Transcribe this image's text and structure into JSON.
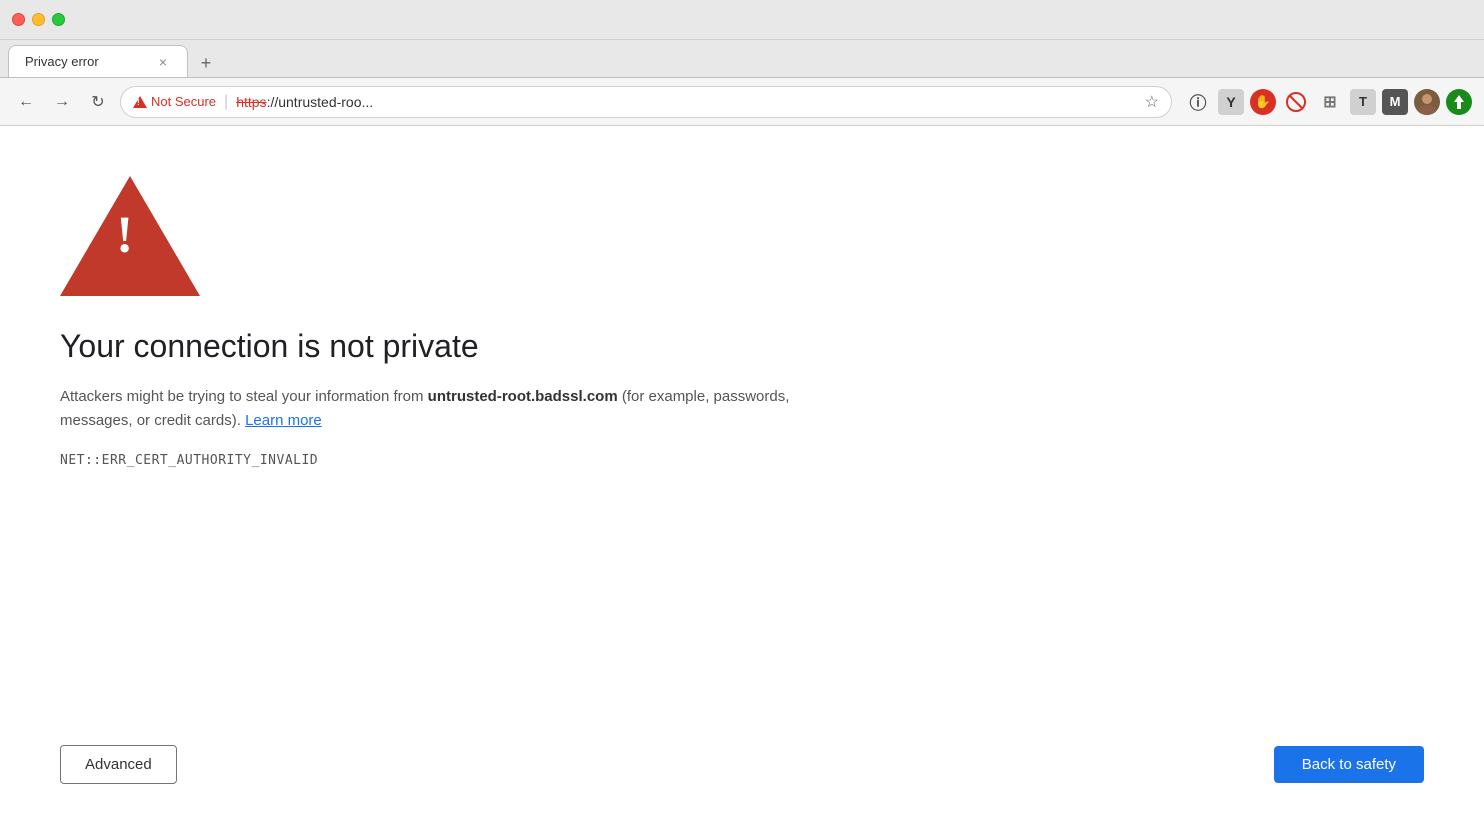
{
  "window": {
    "tab_title": "Privacy error",
    "tab_close": "×",
    "new_tab": "+"
  },
  "nav": {
    "back_label": "←",
    "forward_label": "→",
    "reload_label": "↻",
    "not_secure_label": "Not Secure",
    "url_prefix_strikethrough": "https",
    "url_suffix": "://untrusted-roo...",
    "bookmark_label": "☆"
  },
  "extensions": {
    "info_icon": "ⓘ",
    "y_icon": "Y",
    "hand_icon": "✋",
    "block_icon": "🚫",
    "grid_icon": "⊞",
    "t_icon": "T",
    "m_icon": "M"
  },
  "page": {
    "title": "Your connection is not private",
    "description_before": "Attackers might be trying to steal your information from ",
    "domain_bold": "untrusted-root.badssl.com",
    "description_after": " (for example, passwords, messages, or credit cards). ",
    "learn_more_label": "Learn more",
    "error_code": "NET::ERR_CERT_AUTHORITY_INVALID"
  },
  "buttons": {
    "advanced_label": "Advanced",
    "back_to_safety_label": "Back to safety"
  }
}
